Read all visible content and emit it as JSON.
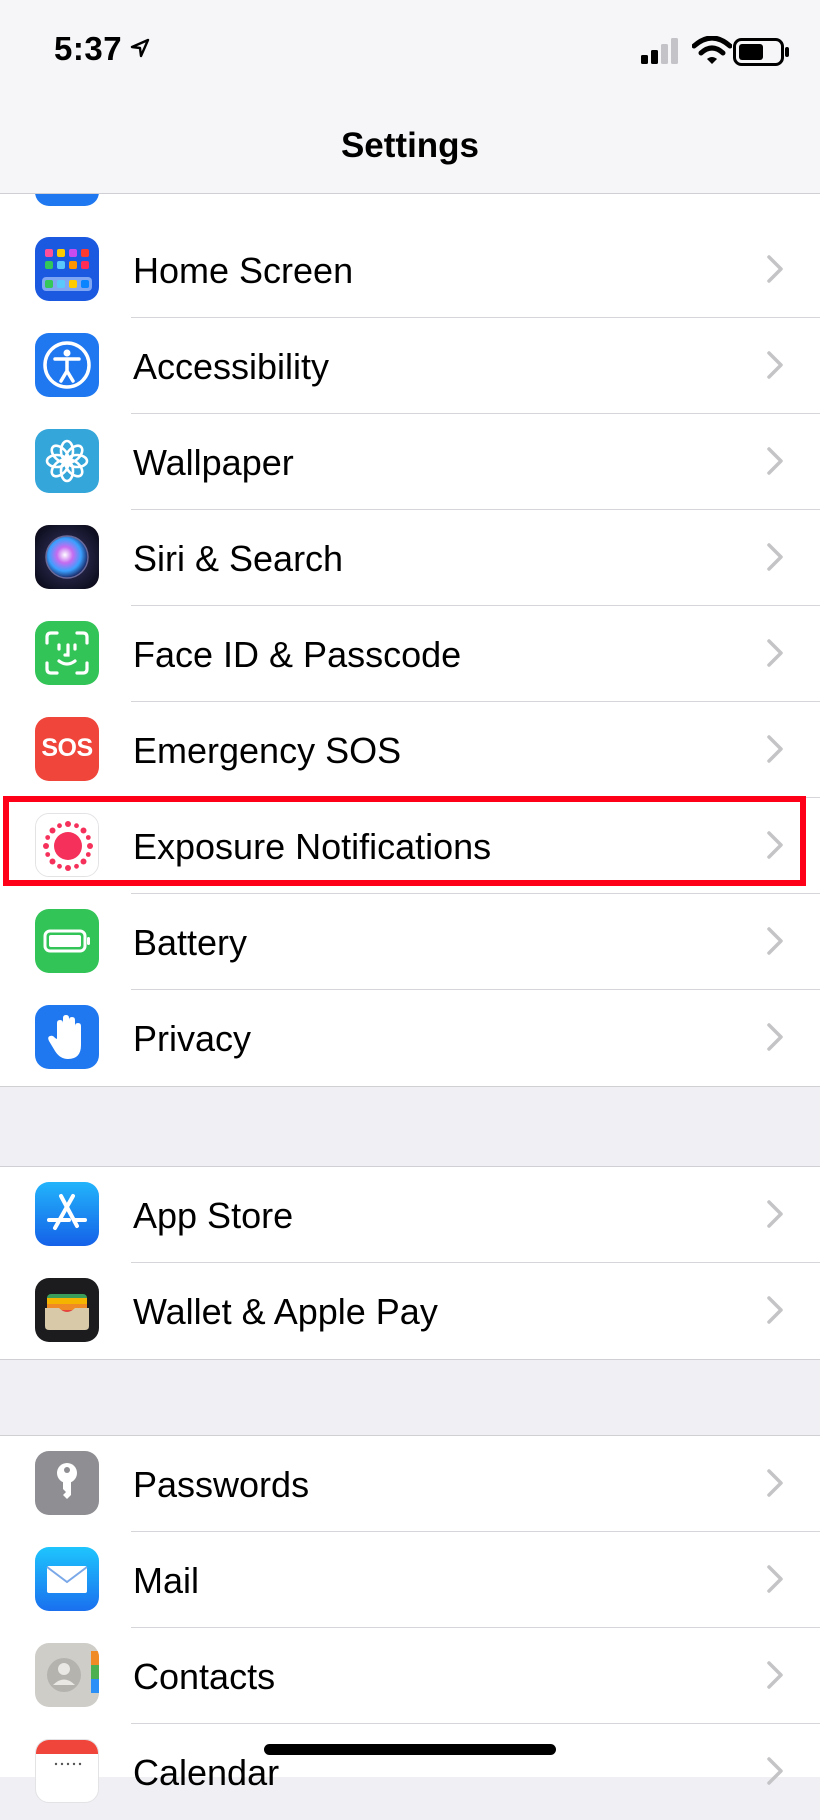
{
  "status": {
    "time": "5:37"
  },
  "nav": {
    "title": "Settings"
  },
  "groups": [
    {
      "items": [
        {
          "label": "Home Screen",
          "icon": "home-screen-icon",
          "color": "#1a59e0"
        },
        {
          "label": "Accessibility",
          "icon": "accessibility-icon",
          "color": "#1f78f0"
        },
        {
          "label": "Wallpaper",
          "icon": "wallpaper-icon",
          "color": "#34a6d9"
        },
        {
          "label": "Siri & Search",
          "icon": "siri-icon",
          "color": "#1b1b3a"
        },
        {
          "label": "Face ID & Passcode",
          "icon": "face-id-icon",
          "color": "#33c458"
        },
        {
          "label": "Emergency SOS",
          "icon": "sos-icon",
          "color": "#f0453a",
          "icon_text": "SOS"
        },
        {
          "label": "Exposure Notifications",
          "icon": "exposure-notifications-icon",
          "color": "#ffffff",
          "highlighted": true
        },
        {
          "label": "Battery",
          "icon": "battery-icon",
          "color": "#33c458"
        },
        {
          "label": "Privacy",
          "icon": "hand-icon",
          "color": "#1f78f0"
        }
      ]
    },
    {
      "items": [
        {
          "label": "App Store",
          "icon": "app-store-icon",
          "color": "#1d8cf5"
        },
        {
          "label": "Wallet & Apple Pay",
          "icon": "wallet-icon",
          "color": "#1c1c1e"
        }
      ]
    },
    {
      "items": [
        {
          "label": "Passwords",
          "icon": "key-icon",
          "color": "#8e8e93"
        },
        {
          "label": "Mail",
          "icon": "mail-icon",
          "color": "#2a8ff7"
        },
        {
          "label": "Contacts",
          "icon": "contacts-icon",
          "color": "#cfcdc8"
        },
        {
          "label": "Calendar",
          "icon": "calendar-icon",
          "color": "#ffffff"
        }
      ]
    }
  ]
}
